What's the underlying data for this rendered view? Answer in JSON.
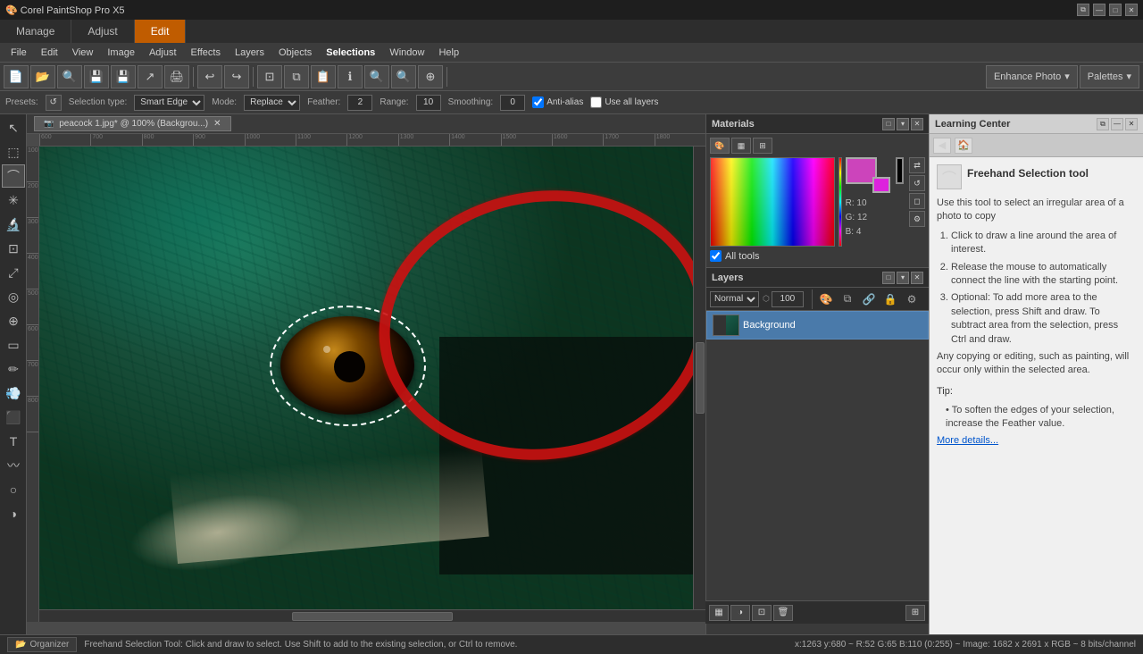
{
  "app": {
    "title": "Corel PaintShop Pro X5",
    "logo": "🎨"
  },
  "navtabs": {
    "items": [
      {
        "label": "Manage",
        "active": false
      },
      {
        "label": "Adjust",
        "active": false
      },
      {
        "label": "Edit",
        "active": true
      }
    ]
  },
  "winbtns": {
    "minimize": "—",
    "maximize": "□",
    "close": "✕",
    "extra": "⧉"
  },
  "menubar": {
    "items": [
      {
        "label": "File"
      },
      {
        "label": "Edit"
      },
      {
        "label": "View"
      },
      {
        "label": "Image"
      },
      {
        "label": "Adjust"
      },
      {
        "label": "Effects"
      },
      {
        "label": "Layers"
      },
      {
        "label": "Objects"
      },
      {
        "label": "Selections"
      },
      {
        "label": "Window"
      },
      {
        "label": "Help"
      }
    ]
  },
  "optbar": {
    "presets_label": "Presets:",
    "presets_icon": "↺",
    "seltype_label": "Selection type:",
    "seltype_value": "Smart Edge",
    "mode_label": "Mode:",
    "mode_value": "Replace",
    "feather_label": "Feather:",
    "feather_value": "2",
    "range_label": "Range:",
    "range_value": "10",
    "smoothing_label": "Smoothing:",
    "smoothing_value": "0",
    "antialias_label": "Anti-alias",
    "antialias_checked": true,
    "usealllayers_label": "Use all layers",
    "usealllayers_checked": false
  },
  "canvas": {
    "tab_title": "peacock 1.jpg* @ 100% (Backgrou...)",
    "close_icon": "✕"
  },
  "ruler": {
    "marks_h": [
      "600",
      "700",
      "800",
      "900",
      "1000",
      "1100",
      "1200",
      "1300",
      "1400",
      "1500",
      "1600",
      "1700",
      "1800"
    ]
  },
  "materials": {
    "title": "Materials",
    "color_r": "R: 10",
    "color_g": "G: 12",
    "color_b": "B: 4",
    "all_tools_label": "All tools"
  },
  "layers": {
    "title": "Layers",
    "blend_mode": "Normal",
    "opacity": "100",
    "layer_name": "Background"
  },
  "learning_center": {
    "title": "Learning Center",
    "tool_title": "Freehand Selection tool",
    "intro": "this tool to select an irregular area of a photo to copy",
    "steps": [
      "to draw a line around the area of interest.",
      "the mouse to automatically connect the line with the starting point.",
      "Optional: To add more area to the selection, press Shift and draw. To subtract area from the selection, press Ctrl and draw."
    ],
    "tip_label": "Tip:",
    "tips": [
      "To soften the edges of your selection, increase the Feather value."
    ],
    "more_details": "More details..."
  },
  "statusbar": {
    "message": "Freehand Selection Tool: Click and draw to select. Use Shift to add to the existing selection, or Ctrl to remove.",
    "coords": "x:1263 y:680 ~ R:52 G:65 B:110 (0:255) ~ Image: 1682 x 2691 x RGB ~ 8 bits/channel",
    "organizer": "Organizer"
  },
  "toolbar_icons": {
    "new": "📄",
    "open": "📂",
    "browse": "🔍",
    "save": "💾",
    "print": "🖨️",
    "share": "↗",
    "undo": "↩",
    "redo": "↪",
    "crop": "✂",
    "copy": "⧉",
    "paste": "📋",
    "info": "ℹ",
    "zoomin": "+",
    "zoomout": "-",
    "enhance": "Enhance Photo",
    "palettes": "Palettes"
  },
  "tools": [
    {
      "name": "move-tool",
      "icon": "✥"
    },
    {
      "name": "selection-tool",
      "icon": "⬚"
    },
    {
      "name": "freehand-selection",
      "icon": "⌓"
    },
    {
      "name": "magic-wand",
      "icon": "⚡"
    },
    {
      "name": "dropper",
      "icon": "💧"
    },
    {
      "name": "crop",
      "icon": "⊡"
    },
    {
      "name": "straighten",
      "icon": "⟺"
    },
    {
      "name": "red-eye",
      "icon": "👁"
    },
    {
      "name": "clone",
      "icon": "⊕"
    },
    {
      "name": "eraser",
      "icon": "◻"
    },
    {
      "name": "paintbrush",
      "icon": "✏"
    },
    {
      "name": "airbrush",
      "icon": "💨"
    },
    {
      "name": "fill",
      "icon": "⬛"
    },
    {
      "name": "text",
      "icon": "T"
    },
    {
      "name": "warp",
      "icon": "〰"
    },
    {
      "name": "dodge",
      "icon": "○"
    },
    {
      "name": "blend",
      "icon": "◑"
    }
  ]
}
